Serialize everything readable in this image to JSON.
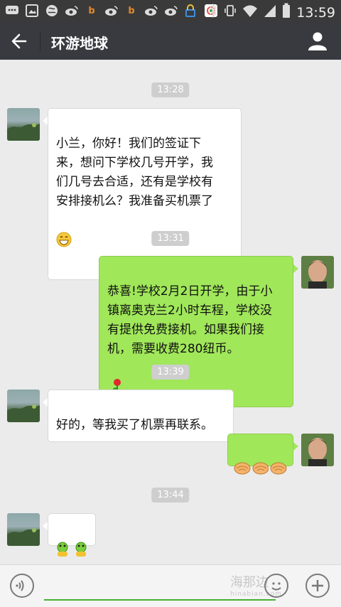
{
  "status_bar": {
    "time": "13:59",
    "left_icons": [
      "message-icon",
      "image-icon",
      "globe-icon",
      "weibo-icon",
      "taobao-icon",
      "weibo-icon",
      "taobao-icon",
      "weibo-icon",
      "weibo-icon",
      "wifi-lock-icon",
      "photo-icon"
    ],
    "right_icons": [
      "bluetooth-icon",
      "vibrate-icon",
      "wifi-icon",
      "signal-icon",
      "battery-icon"
    ]
  },
  "header": {
    "title": "环游地球"
  },
  "messages": [
    {
      "type": "time",
      "text": "13:28"
    },
    {
      "side": "left",
      "text": "小兰，你好！我们的签证下\n来，想问下学校几号开学，我\n们几号去合适，还有是学校有\n安排接机么？我准备买机票了",
      "emoji": "grin-emoji"
    },
    {
      "type": "time",
      "text": "13:31"
    },
    {
      "side": "right",
      "text": "恭喜!学校2月2日开学，由于小\n镇离奥克兰2小时车程，学校没\n有提供免费接机。如果我们接\n机，需要收费280纽币。",
      "emoji": "rose-emoji"
    },
    {
      "type": "time",
      "text": "13:39"
    },
    {
      "side": "left",
      "text": "好的，等我买了机票再联系。"
    },
    {
      "side": "right",
      "emoji": "handshake-emoji-x3"
    },
    {
      "type": "time",
      "text": "13:44"
    },
    {
      "side": "left",
      "emoji": "frog-emoji-x2"
    }
  ],
  "input_bar": {
    "watermark": "海那边",
    "watermark_sub": "hinabian.com"
  },
  "colors": {
    "title_bar": "#393a3f",
    "chat_bg": "#ebebeb",
    "bubble_right": "#a0e75a",
    "bubble_left": "#ffffff",
    "input_line": "#45b035"
  }
}
